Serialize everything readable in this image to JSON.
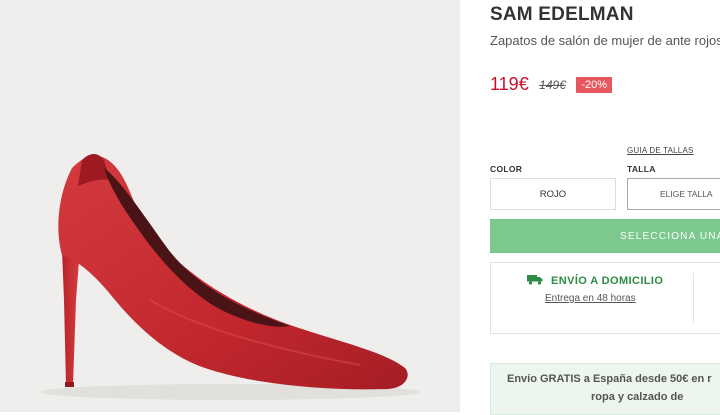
{
  "product": {
    "brand": "SAM EDELMAN",
    "subtitle": "Zapatos de salón de mujer de ante rojos",
    "price_current": "119€",
    "price_old": "149€",
    "discount": "-20%"
  },
  "options": {
    "size_guide_label": "GUIA DE TALLAS",
    "color_label": "COLOR",
    "color_value": "ROJO",
    "size_label": "TALLA",
    "size_placeholder": "ELIGE TALLA",
    "select_button": "SELECCIONA UNA VA"
  },
  "shipping": {
    "title": "ENVÍO A DOMICILIO",
    "subtitle": "Entrega en 48 horas"
  },
  "promo": {
    "line1": "Envío GRATIS a España desde 50€ en r",
    "line2": "ropa y calzado de"
  },
  "colors": {
    "price": "#c8102e",
    "discount_bg": "#e8575e",
    "cta": "#7cc88e",
    "shipping_accent": "#2e8b46",
    "shoe": "#c42a31"
  },
  "icons": {
    "size_chevron": "chevron-down-icon",
    "shipping": "truck-icon"
  }
}
